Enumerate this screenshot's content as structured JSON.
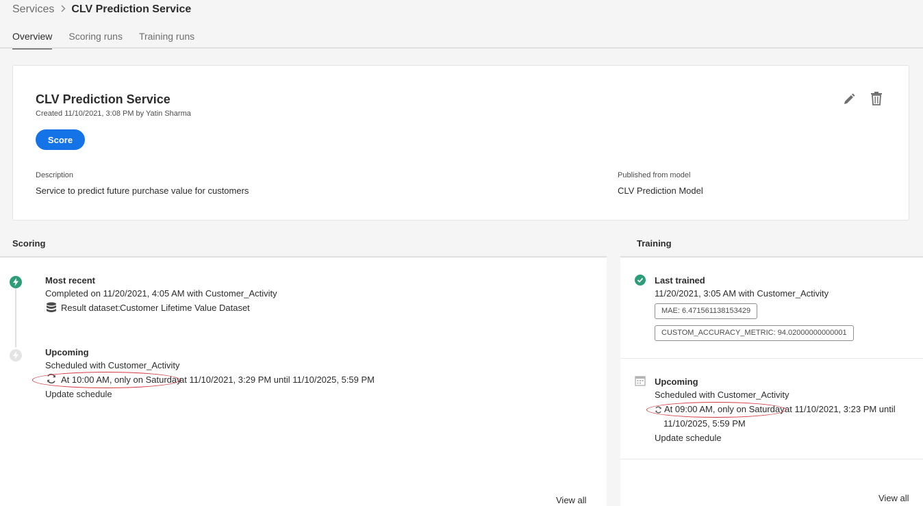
{
  "breadcrumb": {
    "parent": "Services",
    "current": "CLV Prediction Service"
  },
  "tabs": [
    {
      "label": "Overview",
      "active": true
    },
    {
      "label": "Scoring runs",
      "active": false
    },
    {
      "label": "Training runs",
      "active": false
    }
  ],
  "service": {
    "title": "CLV Prediction Service",
    "created": "Created 11/10/2021, 3:08 PM by Yatin Sharma",
    "score_button": "Score",
    "description_label": "Description",
    "description": "Service to predict future purchase value for customers",
    "published_label": "Published from model",
    "published_model": "CLV Prediction Model"
  },
  "scoring": {
    "heading": "Scoring",
    "recent": {
      "title": "Most recent",
      "completed": "Completed on 11/20/2021, 4:05 AM with Customer_Activity",
      "result_label": "Result dataset:",
      "result_link": "Customer Lifetime Value Dataset"
    },
    "upcoming": {
      "title": "Upcoming",
      "scheduled": "Scheduled with Customer_Activity",
      "schedule": "At 10:00 AM, only on Saturday",
      "range": "at 11/10/2021, 3:29 PM until 11/10/2025, 5:59 PM",
      "update": "Update schedule"
    },
    "view_all": "View all"
  },
  "training": {
    "heading": "Training",
    "last": {
      "title": "Last trained",
      "text": "11/20/2021, 3:05 AM with Customer_Activity",
      "metrics": [
        "MAE: 6.471561138153429",
        "CUSTOM_ACCURACY_METRIC: 94.02000000000001"
      ]
    },
    "upcoming": {
      "title": "Upcoming",
      "scheduled": "Scheduled with Customer_Activity",
      "schedule": "At 09:00 AM, only on Saturday",
      "range1": "at 11/10/2021, 3:23 PM until",
      "range2": "11/10/2025, 5:59 PM",
      "update": "Update schedule"
    },
    "view_all": "View all"
  },
  "colors": {
    "accent": "#1473e6",
    "success": "#2d9d78",
    "annotation": "#d7373f"
  }
}
